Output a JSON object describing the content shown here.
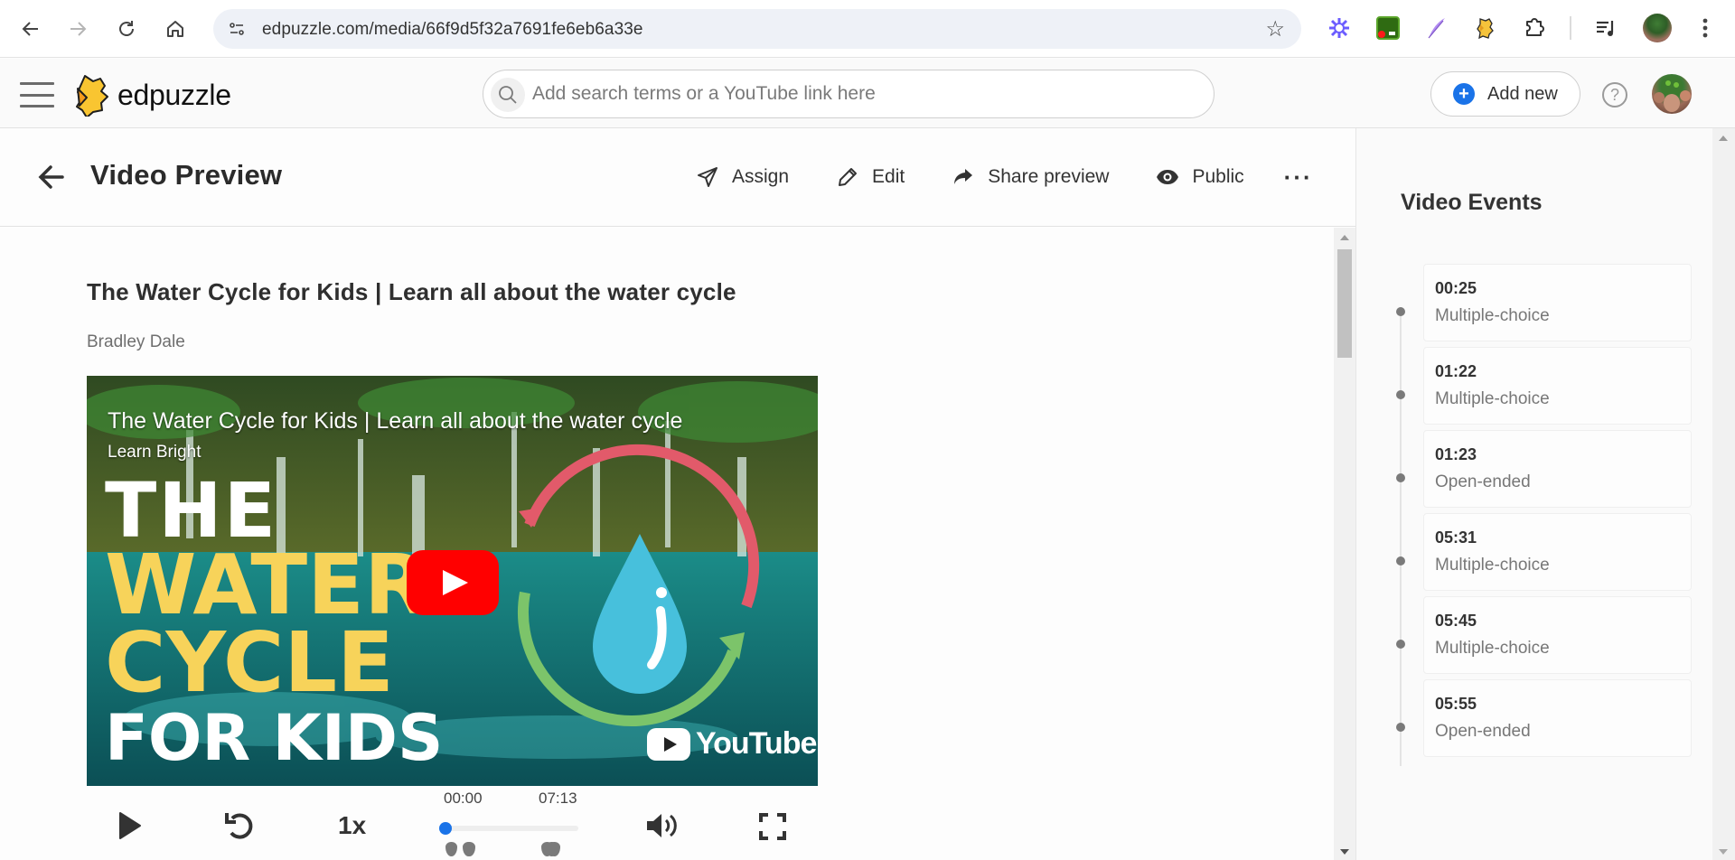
{
  "browser": {
    "url": "edpuzzle.com/media/66f9d5f32a7691fe6eb6a33e",
    "nav": [
      "back-icon",
      "forward-icon",
      "reload-icon",
      "home-icon"
    ],
    "extensions": [
      "perplexity-icon",
      "green-extension-icon",
      "feather-pen-icon",
      "edpuzzle-extension-icon",
      "extensions-puzzle-icon",
      "media-controls-icon",
      "profile-avatar",
      "menu-kebab-icon"
    ]
  },
  "header": {
    "brand": "edpuzzle",
    "search_placeholder": "Add search terms or a YouTube link here",
    "add_new_label": "Add new",
    "help_symbol": "?",
    "accent": "#1a73e8"
  },
  "page": {
    "title": "Video Preview",
    "actions": [
      {
        "label": "Assign",
        "icon": "paper-plane-icon"
      },
      {
        "label": "Edit",
        "icon": "pencil-icon"
      },
      {
        "label": "Share preview",
        "icon": "share-arrow-icon"
      },
      {
        "label": "Public",
        "icon": "eye-icon"
      }
    ],
    "more_label": "···"
  },
  "video": {
    "title": "The Water Cycle for Kids | Learn all about the water cycle",
    "author": "Bradley Dale",
    "thumbnail": {
      "overlay_title": "The Water Cycle for Kids | Learn all about the water cycle",
      "channel": "Learn Bright",
      "lines": [
        "THE",
        "WATER",
        "CYCLE",
        "FOR KIDS"
      ],
      "youtube_label": "YouTube"
    },
    "player": {
      "current_time": "00:00",
      "duration": "07:13",
      "speed": "1x",
      "progress": 0,
      "question_markers": [
        "00:25",
        "01:22",
        "01:23",
        "05:31",
        "05:45",
        "05:55"
      ]
    }
  },
  "events": {
    "title": "Video Events",
    "items": [
      {
        "time": "00:25",
        "type": "Multiple-choice"
      },
      {
        "time": "01:22",
        "type": "Multiple-choice"
      },
      {
        "time": "01:23",
        "type": "Open-ended"
      },
      {
        "time": "05:31",
        "type": "Multiple-choice"
      },
      {
        "time": "05:45",
        "type": "Multiple-choice"
      },
      {
        "time": "05:55",
        "type": "Open-ended"
      }
    ]
  }
}
